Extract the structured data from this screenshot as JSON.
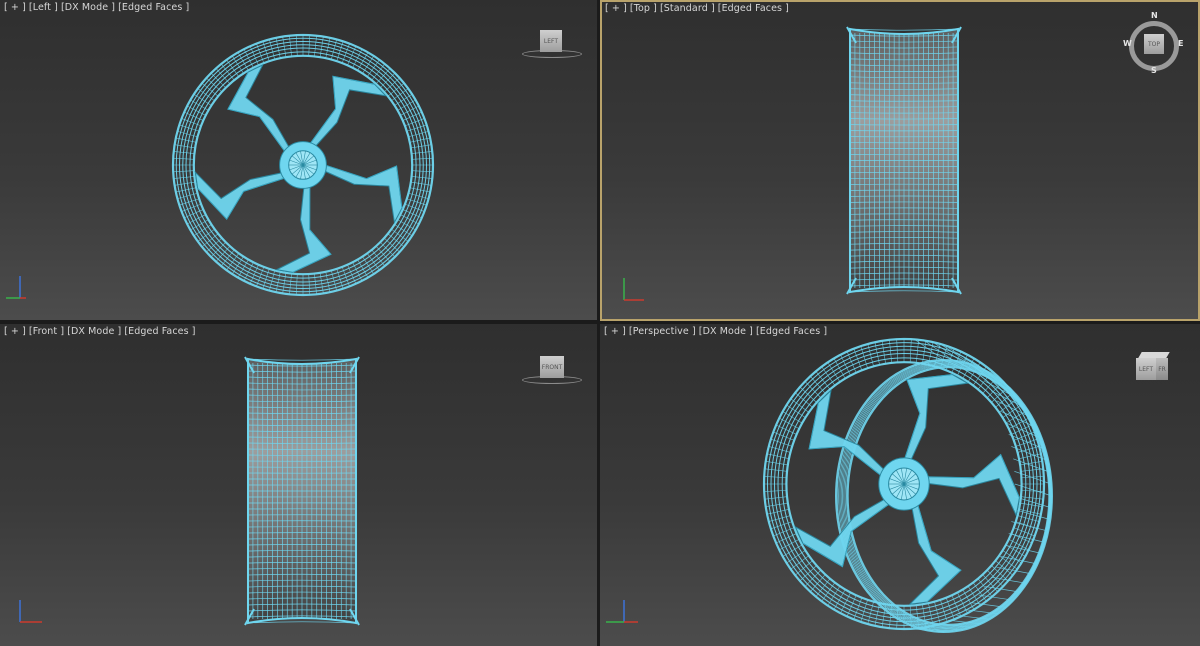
{
  "colors": {
    "wire": "#6fd6ef",
    "wire_dark": "#2a8aa2",
    "axis_x": "#cc3a2e",
    "axis_y": "#39b24a",
    "axis_z": "#3d72d9",
    "active_border": "#b9a36b"
  },
  "viewports": {
    "left": {
      "labels": [
        "[ + ]",
        "[Left ]",
        "[DX Mode ]",
        "[Edged Faces ]"
      ],
      "cube_label": "LEFT",
      "gizmo_icon": "axis-tripod-icon"
    },
    "top": {
      "labels": [
        "[ + ]",
        "[Top ]",
        "[Standard ]",
        "[Edged Faces ]"
      ],
      "cube_label": "TOP",
      "compass": {
        "n": "N",
        "s": "S",
        "e": "E",
        "w": "W"
      },
      "gizmo_icon": "axis-tripod-icon",
      "active": true
    },
    "front": {
      "labels": [
        "[ + ]",
        "[Front ]",
        "[DX Mode ]",
        "[Edged Faces ]"
      ],
      "cube_label": "FRONT",
      "gizmo_icon": "axis-tripod-icon"
    },
    "persp": {
      "labels": [
        "[ + ]",
        "[Perspective ]",
        "[DX Mode ]",
        "[Edged Faces ]"
      ],
      "cube_left": "LEFT",
      "cube_front": "FR",
      "gizmo_icon": "axis-tripod-icon"
    }
  }
}
